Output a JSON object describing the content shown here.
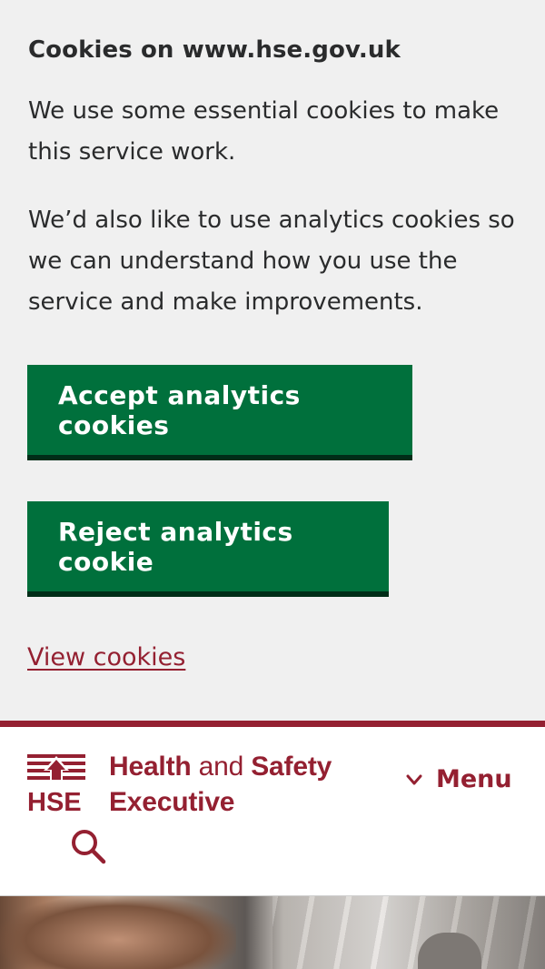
{
  "cookie_banner": {
    "title": "Cookies on www.hse.gov.uk",
    "paragraph_1": "We use some essential cookies to make this service work.",
    "paragraph_2": "We’d also like to use analytics cookies so we can understand how you use the service and make improvements.",
    "accept_label": "Accept analytics cookies",
    "reject_label": "Reject analytics cookie",
    "view_link": "View cookies"
  },
  "header": {
    "logo_abbr": "HSE",
    "logo_line1_bold": "Health",
    "logo_line1_light": "and",
    "logo_line1_bold2": "Safety",
    "logo_line2": "Executive",
    "menu_label": "Menu",
    "search_icon": "search-icon",
    "menu_icon": "chevron-down-icon"
  },
  "colors": {
    "brand": "#942031",
    "button_green": "#00703c",
    "banner_bg": "#f0f0f0"
  }
}
